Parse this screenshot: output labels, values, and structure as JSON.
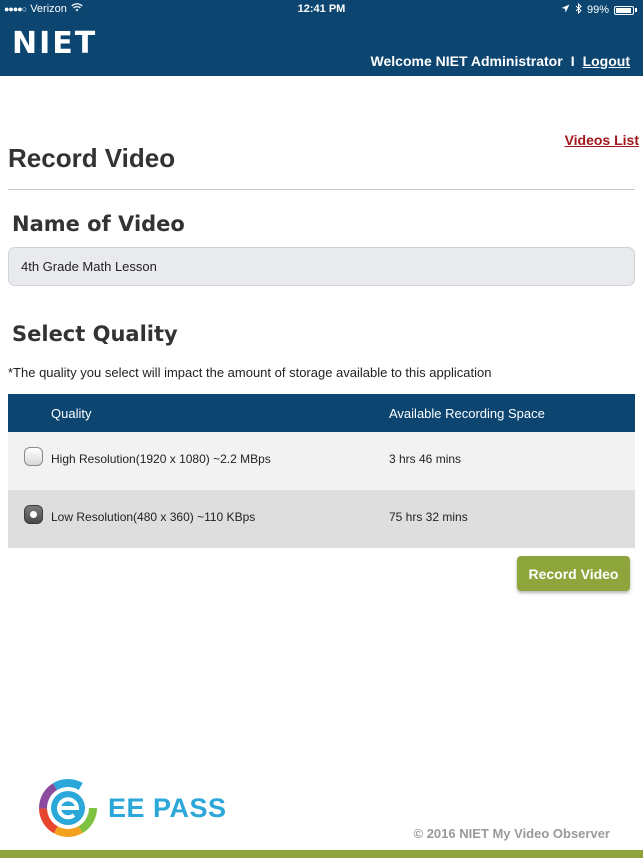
{
  "status_bar": {
    "carrier": "Verizon",
    "time": "12:41 PM",
    "battery": "99%"
  },
  "header": {
    "logo": "NIET",
    "welcome": "Welcome NIET Administrator",
    "separator": "I",
    "logout": "Logout"
  },
  "nav": {
    "videos_list": "Videos List"
  },
  "page": {
    "title": "Record Video"
  },
  "name_section": {
    "title": "Name of Video",
    "value": "4th Grade Math Lesson"
  },
  "quality_section": {
    "title": "Select Quality",
    "note": "*The quality you select will impact the amount of storage available to this application",
    "columns": [
      "Quality",
      "Available Recording Space"
    ],
    "options": [
      {
        "label": "High Resolution(1920 x 1080) ~2.2 MBps",
        "space": "3 hrs 46 mins",
        "selected": false
      },
      {
        "label": "Low Resolution(480 x 360) ~110 KBps",
        "space": "75 hrs 32 mins",
        "selected": true
      }
    ]
  },
  "actions": {
    "record": "Record Video"
  },
  "footer": {
    "brand": "EE PASS",
    "copyright": "© 2016 NIET My Video Observer"
  },
  "colors": {
    "header_bg": "#0b4570",
    "accent_green": "#8ea53b",
    "link_red": "#a3161b",
    "brand_blue": "#2ba8d9"
  }
}
